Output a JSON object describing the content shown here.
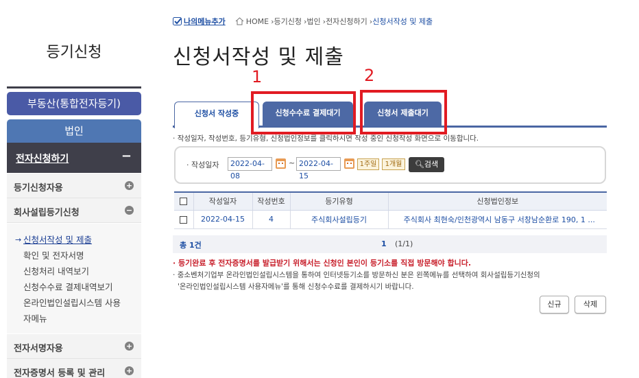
{
  "sidebar": {
    "title": "등기신청",
    "realestate_button": "부동산(통합전자등기)",
    "corp_button": "법인",
    "active_menu": "전자신청하기",
    "active_menu_toggle": "−",
    "sections": [
      {
        "label": "등기신청자용",
        "toggle": "+"
      },
      {
        "label": "회사설립등기신청",
        "toggle": "−"
      },
      {
        "label": "전자서명자용",
        "toggle": "+"
      },
      {
        "label": "전자증명서 등록 및 관리",
        "toggle": "+"
      }
    ],
    "submenu": [
      "신청서작성 및 제출",
      "확인 및 전자서명",
      "신청처리 내역보기",
      "신청수수료 결제내역보기",
      "온라인법인설립시스템 사용",
      "자메뉴"
    ]
  },
  "breadcrumb": {
    "mymenu": "나의메뉴추가",
    "home": "HOME",
    "items": [
      "등기신청",
      "법인",
      "전자신청하기"
    ],
    "current": "신청서작성 및 제출"
  },
  "page_title": "신청서작성 및 제출",
  "tabs": [
    "신청서 작성중",
    "신청수수료 결제대기",
    "신청서 제출대기"
  ],
  "note_top": "작성일자, 작성번호, 등기유형, 신청법인정보를 클릭하시면 작성 중인 신청작성 화면으로 이동합니다.",
  "search": {
    "label": "작성일자",
    "from": "2022-04-08",
    "tilde": "~",
    "to": "2022-04-15",
    "week_btn": "1주일",
    "month_btn": "1개월",
    "search_btn": "검색"
  },
  "table": {
    "headers": [
      "작성일자",
      "작성번호",
      "등기유형",
      "신청법인정보"
    ],
    "rows": [
      {
        "date": "2022-04-15",
        "no": "4",
        "type": "주식회사설립등기",
        "info": "주식회사 최현숙/인천광역시 남동구 서창남순환로 190, 1 ..."
      }
    ]
  },
  "pager": {
    "total": "총 1건",
    "page": "1",
    "of": "(1/1)"
  },
  "warning": "등기완료 후 전자증명서를 발급받기 위해서는 신청인 본인이 등기소를 직접 방문해야 합니다.",
  "note_bottom": [
    "중소벤처기업부 온라인법인설립시스템을 통하여 인터넷등기소를 방문하신 분은 왼쪽메뉴를 선택하여 회사설립등기신청의",
    "'온라인법인설립시스템 사용자메뉴'를 통해 신청수수료를 결제하시기 바랍니다."
  ],
  "buttons": {
    "new": "신규",
    "delete": "삭제"
  },
  "annotations": [
    "1",
    "2"
  ],
  "colors": {
    "accent": "#4a66a3",
    "tab_bg": "#4d69a5",
    "highlight": "#e11b22",
    "warning": "#c8202c"
  }
}
